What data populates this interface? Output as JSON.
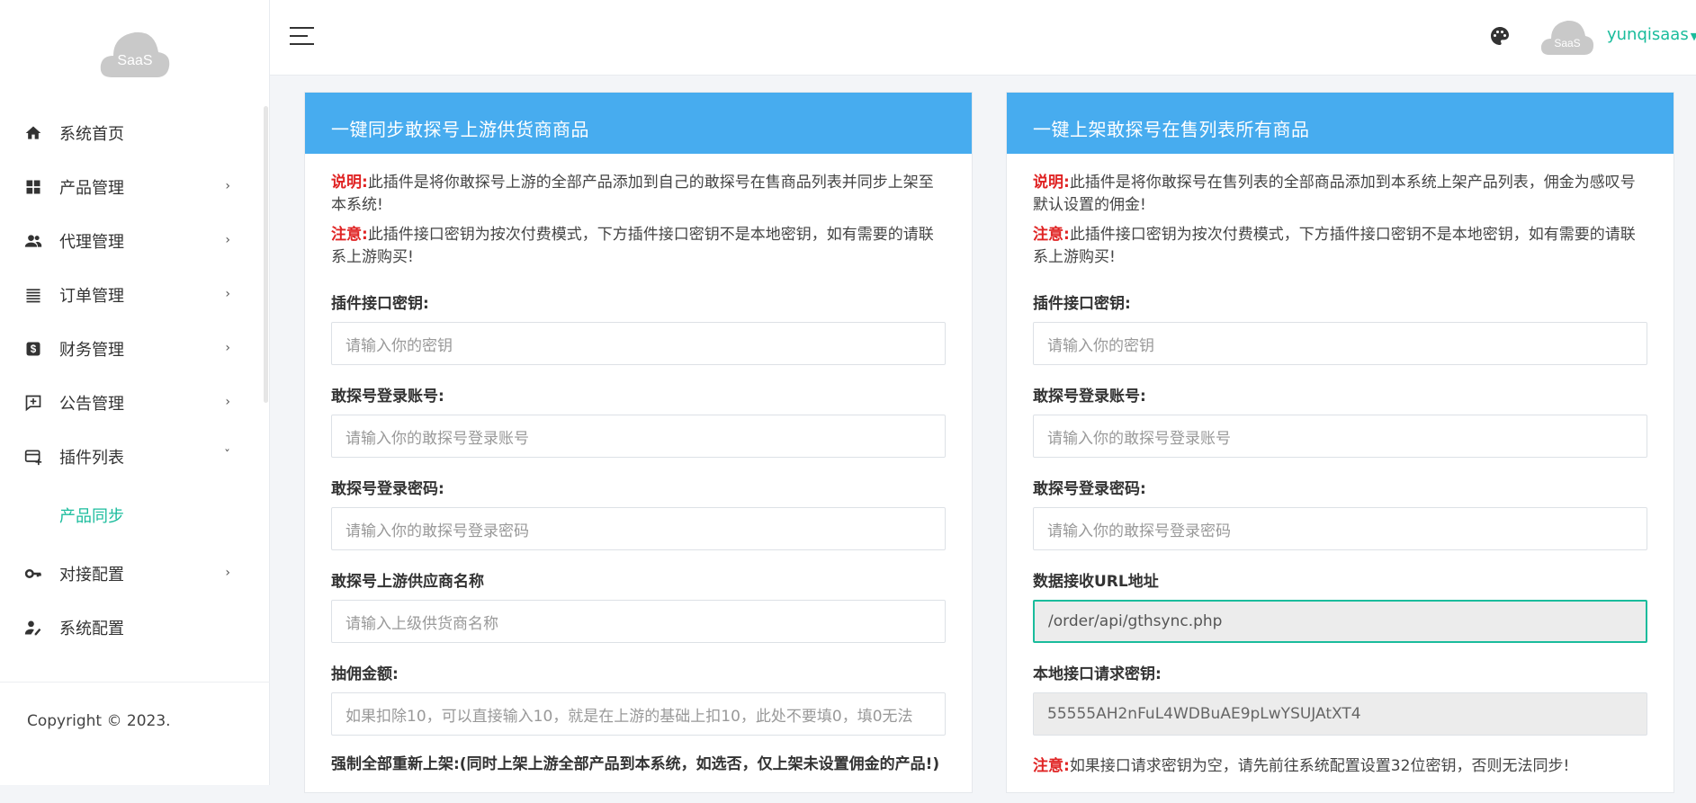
{
  "brand": {
    "logo_text": "SaaS"
  },
  "sidebar": {
    "items": [
      {
        "label": "系统首页",
        "icon": "home-icon"
      },
      {
        "label": "产品管理",
        "icon": "grid-icon"
      },
      {
        "label": "代理管理",
        "icon": "people-icon"
      },
      {
        "label": "订单管理",
        "icon": "list-icon"
      },
      {
        "label": "财务管理",
        "icon": "dollar-icon"
      },
      {
        "label": "公告管理",
        "icon": "announcement-icon"
      },
      {
        "label": "插件列表",
        "icon": "card-icon"
      },
      {
        "label": "对接配置",
        "icon": "key-icon"
      },
      {
        "label": "系统配置",
        "icon": "user-settings-icon"
      }
    ],
    "sub_item": "产品同步",
    "copyright": "Copyright © 2023."
  },
  "header": {
    "username": "yunqisaas",
    "avatar_text": "SaaS"
  },
  "left_card": {
    "title": "一键同步敢探号上游供货商商品",
    "note1_prefix": "说明:",
    "note1_text": "此插件是将你敢探号上游的全部产品添加到自己的敢探号在售商品列表并同步上架至本系统!",
    "note2_prefix": "注意:",
    "note2_text": "此插件接口密钥为按次付费模式，下方插件接口密钥不是本地密钥，如有需要的请联系上游购买!",
    "fields": [
      {
        "label": "插件接口密钥:",
        "placeholder": "请输入你的密钥"
      },
      {
        "label": "敢探号登录账号:",
        "placeholder": "请输入你的敢探号登录账号"
      },
      {
        "label": "敢探号登录密码:",
        "placeholder": "请输入你的敢探号登录密码"
      },
      {
        "label": "敢探号上游供应商名称",
        "placeholder": "请输入上级供货商名称"
      },
      {
        "label": "抽佣金额:",
        "placeholder": "如果扣除10，可以直接输入10，就是在上游的基础上扣10，此处不要填0，填0无法"
      }
    ],
    "force_label": "强制全部重新上架:(同时上架上游全部产品到本系统，如选否，仅上架未设置佣金的产品!)"
  },
  "right_card": {
    "title": "一键上架敢探号在售列表所有商品",
    "note1_prefix": "说明:",
    "note1_text": "此插件是将你敢探号在售列表的全部商品添加到本系统上架产品列表，佣金为感叹号默认设置的佣金!",
    "note2_prefix": "注意:",
    "note2_text": "此插件接口密钥为按次付费模式，下方插件接口密钥不是本地密钥，如有需要的请联系上游购买!",
    "fields": [
      {
        "label": "插件接口密钥:",
        "placeholder": "请输入你的密钥"
      },
      {
        "label": "敢探号登录账号:",
        "placeholder": "请输入你的敢探号登录账号"
      },
      {
        "label": "敢探号登录密码:",
        "placeholder": "请输入你的敢探号登录密码"
      },
      {
        "label": "数据接收URL地址",
        "value": "/order/api/gthsync.php"
      },
      {
        "label": "本地接口请求密钥:",
        "value": "55555AH2nFuL4WDBuAE9pLwYSUJAtXT4"
      }
    ],
    "bottom_prefix": "注意:",
    "bottom_text": "如果接口请求密钥为空，请先前往系统配置设置32位密钥，否则无法同步!"
  }
}
